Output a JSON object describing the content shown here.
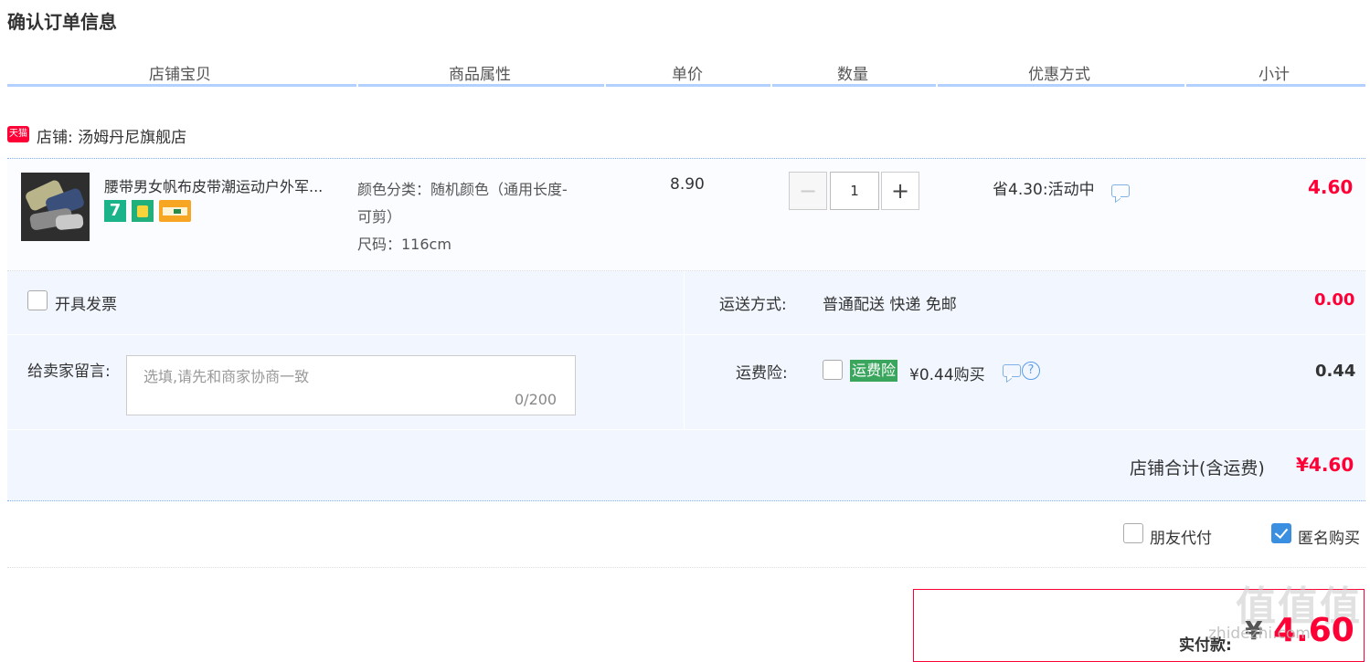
{
  "page_title": "确认订单信息",
  "table_headers": [
    "店铺宝贝",
    "商品属性",
    "单价",
    "数量",
    "优惠方式",
    "小计"
  ],
  "shop": {
    "badge": "天猫",
    "name": "店铺: 汤姆丹尼旗舰店"
  },
  "item": {
    "title": "腰带男女帆布皮带潮运动户外军...",
    "badges": [
      "7",
      "service",
      "card"
    ],
    "attr_color_line1": "颜色分类：随机颜色（通用长度-",
    "attr_color_line2": "可剪）",
    "attr_size": "尺码：116cm",
    "unit_price": "8.90",
    "quantity": "1",
    "promo": "省4.30:活动中",
    "subtotal": "4.60"
  },
  "invoice": {
    "label": "开具发票"
  },
  "shipping": {
    "label": "运送方式:",
    "value": "普通配送 快递 免邮",
    "cost": "0.00"
  },
  "message": {
    "label": "给卖家留言:",
    "placeholder": "选填,请先和商家协商一致",
    "count": "0/200"
  },
  "insurance": {
    "label": "运费险:",
    "tag": "运费险",
    "price": "¥0.44购买",
    "help": "?",
    "cost": "0.44"
  },
  "shop_total": {
    "label": "店铺合计(含运费)",
    "value": "¥4.60"
  },
  "options": {
    "friend_pay": "朋友代付",
    "anonymous": "匿名购买",
    "anonymous_checked": true
  },
  "payment": {
    "label": "实付款:",
    "currency": "¥",
    "value": "4.60"
  },
  "watermark": {
    "text": "值值值",
    "sub": "zhidezhi.com"
  },
  "colors": {
    "accent_red": "#ff0036",
    "header_line": "#b2d1ff",
    "panel_bg": "#f2f7ff",
    "checkbox_blue": "#3b8fe0"
  }
}
